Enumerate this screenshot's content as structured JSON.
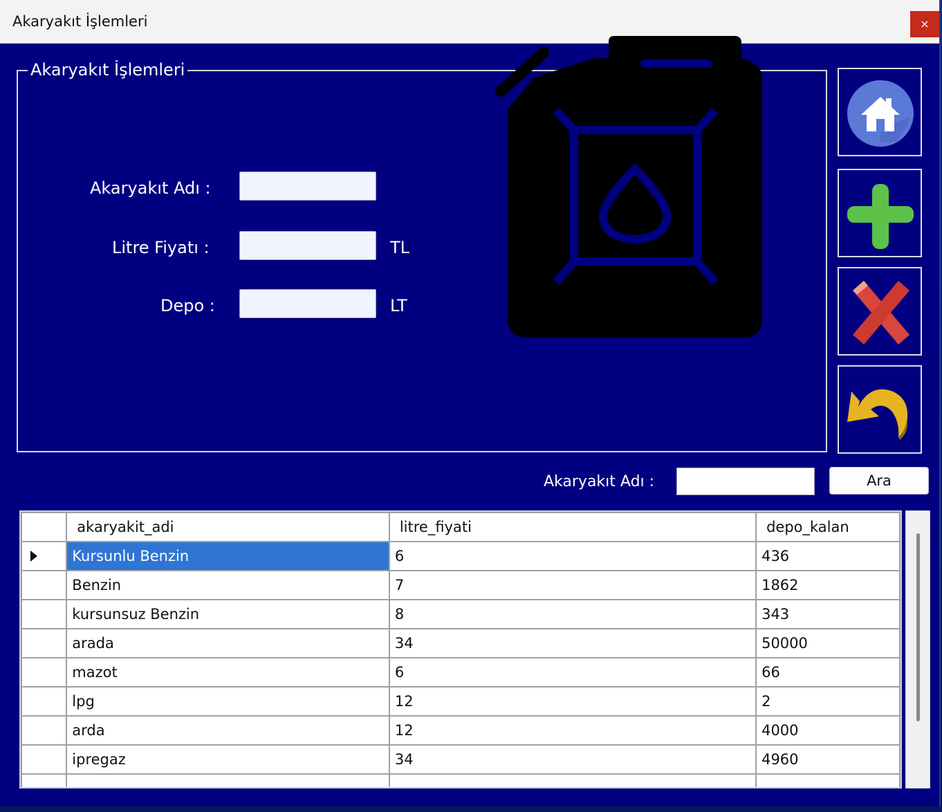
{
  "window": {
    "title": "Akaryakıt İşlemleri",
    "close_glyph": "×"
  },
  "form": {
    "group_title": "Akaryakıt İşlemleri",
    "fields": [
      {
        "label": "Akaryakıt Adı :",
        "value": "",
        "unit": ""
      },
      {
        "label": "Litre Fiyatı :",
        "value": "",
        "unit": "TL"
      },
      {
        "label": "Depo :",
        "value": "",
        "unit": "LT"
      }
    ],
    "icon": "fuel-canister-icon"
  },
  "actions": [
    {
      "name": "home",
      "icon": "home-icon"
    },
    {
      "name": "add",
      "icon": "plus-icon"
    },
    {
      "name": "delete",
      "icon": "delete-x-icon"
    },
    {
      "name": "undo",
      "icon": "undo-arrow-icon"
    }
  ],
  "search": {
    "label": "Akaryakıt Adı :",
    "value": "",
    "button_label": "Ara"
  },
  "table": {
    "columns": [
      "akaryakit_adi",
      "litre_fiyati",
      "depo_kalan"
    ],
    "rows": [
      [
        "Kursunlu Benzin",
        "6",
        "436"
      ],
      [
        "Benzin",
        "7",
        "1862"
      ],
      [
        "kursunsuz Benzin",
        "8",
        "343"
      ],
      [
        "arada",
        "34",
        "50000"
      ],
      [
        "mazot",
        "6",
        "66"
      ],
      [
        "lpg",
        "12",
        "2"
      ],
      [
        "arda",
        "12",
        "4000"
      ],
      [
        "ipregaz",
        "34",
        "4960"
      ]
    ],
    "selected_row": 0
  },
  "colors": {
    "window_bg": "#000080",
    "selection": "#2f76d4",
    "close": "#c42b1c"
  }
}
